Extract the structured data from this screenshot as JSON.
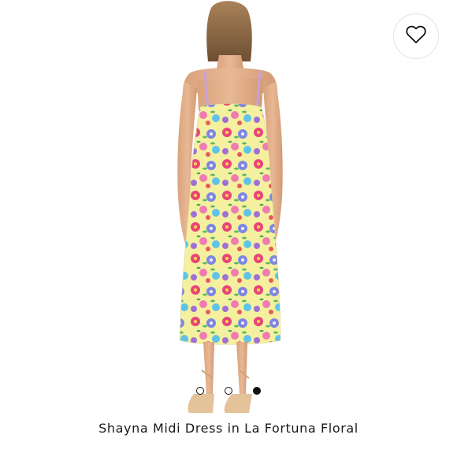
{
  "product": {
    "title": "Shayna Midi Dress in La Fortuna Floral"
  },
  "wishlist": {
    "icon": "heart-outline-icon"
  },
  "carousel": {
    "total_images": 3,
    "active_index": 2
  },
  "colors": {
    "background": "#ffffff",
    "text": "#1a1a1a",
    "dot_active": "#111111"
  }
}
